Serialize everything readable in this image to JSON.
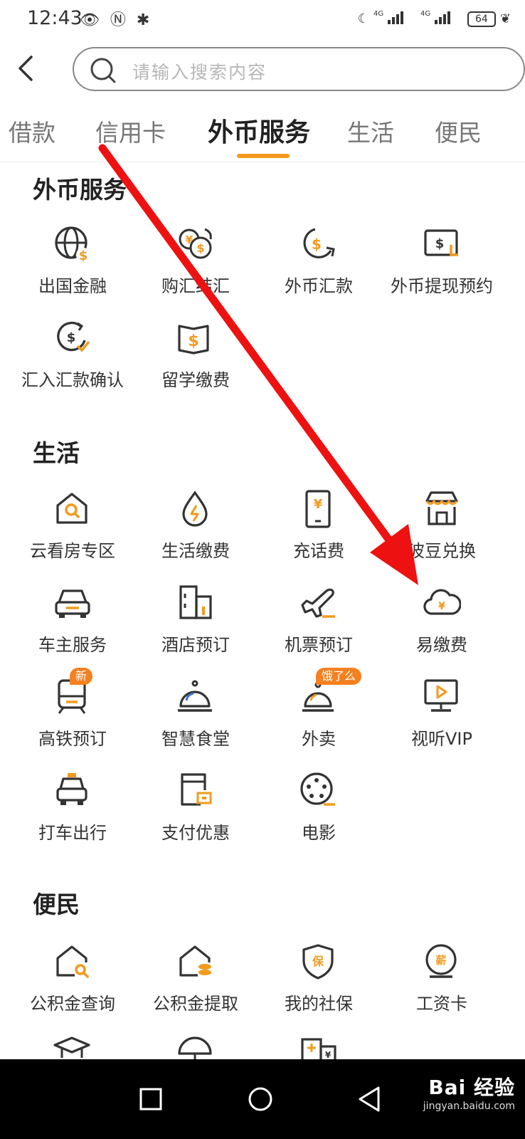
{
  "status_bar": {
    "time": "12:43",
    "left_icons": "👁 Ⓝ ✱",
    "network": "4G",
    "battery": "64"
  },
  "header": {
    "search_placeholder": "请输入搜索内容"
  },
  "tabs": [
    {
      "label": "借款",
      "active": false
    },
    {
      "label": "信用卡",
      "active": false
    },
    {
      "label": "外币服务",
      "active": true
    },
    {
      "label": "生活",
      "active": false
    },
    {
      "label": "便民",
      "active": false
    }
  ],
  "sections": {
    "forex": {
      "title": "外币服务",
      "items": [
        {
          "label": "出国金融",
          "icon": "globe-dollar-icon"
        },
        {
          "label": "购汇结汇",
          "icon": "currency-exchange-icon"
        },
        {
          "label": "外币汇款",
          "icon": "remittance-icon"
        },
        {
          "label": "外币提现预约",
          "icon": "cash-withdraw-icon"
        },
        {
          "label": "汇入汇款确认",
          "icon": "inward-remit-icon"
        },
        {
          "label": "留学缴费",
          "icon": "study-abroad-icon"
        }
      ]
    },
    "life": {
      "title": "生活",
      "items": [
        {
          "label": "云看房专区",
          "icon": "house-search-icon"
        },
        {
          "label": "生活缴费",
          "icon": "utility-drop-icon"
        },
        {
          "label": "充话费",
          "icon": "phone-topup-icon"
        },
        {
          "label": "波豆兑换",
          "icon": "store-icon"
        },
        {
          "label": "车主服务",
          "icon": "car-icon"
        },
        {
          "label": "酒店预订",
          "icon": "hotel-icon"
        },
        {
          "label": "机票预订",
          "icon": "plane-icon"
        },
        {
          "label": "易缴费",
          "icon": "cloud-yen-icon"
        },
        {
          "label": "高铁预订",
          "icon": "train-icon",
          "badge": "新"
        },
        {
          "label": "智慧食堂",
          "icon": "cloche-icon"
        },
        {
          "label": "外卖",
          "icon": "takeout-icon",
          "badge": "饿了么"
        },
        {
          "label": "视听VIP",
          "icon": "video-vip-icon"
        },
        {
          "label": "打车出行",
          "icon": "taxi-icon"
        },
        {
          "label": "支付优惠",
          "icon": "payment-discount-icon"
        },
        {
          "label": "电影",
          "icon": "film-reel-icon"
        }
      ]
    },
    "convenience": {
      "title": "便民",
      "items": [
        {
          "label": "公积金查询",
          "icon": "fund-query-icon"
        },
        {
          "label": "公积金提取",
          "icon": "fund-withdraw-icon"
        },
        {
          "label": "我的社保",
          "icon": "social-insurance-icon"
        },
        {
          "label": "工资卡",
          "icon": "salary-card-icon"
        }
      ],
      "shield_char": "保",
      "salary_char": "薪"
    }
  },
  "watermark": {
    "brand": "Bai 经验",
    "url": "jingyan.baidu.com"
  },
  "colors": {
    "accent": "#f39a1e",
    "badge": "#f5801f",
    "annotation": "#ee1111"
  }
}
